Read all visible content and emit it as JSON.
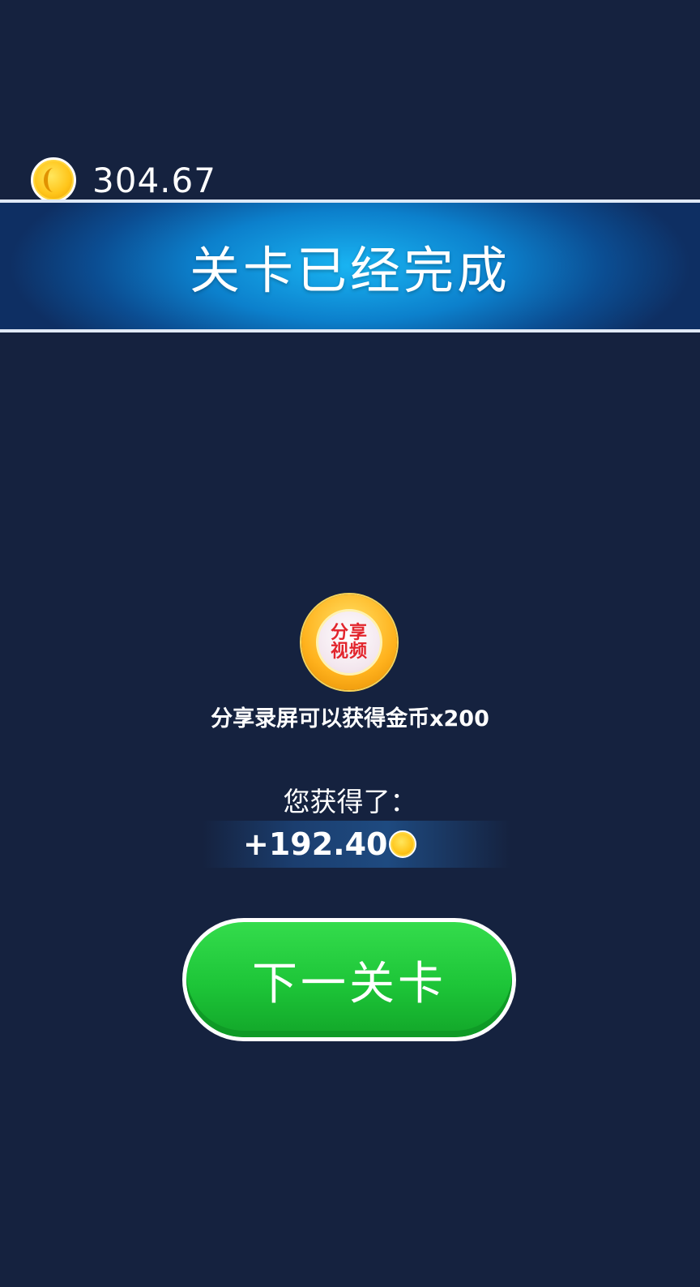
{
  "header": {
    "coin_icon": "gold-coin-icon",
    "balance": "304.67"
  },
  "banner": {
    "title": "关卡已经完成"
  },
  "share": {
    "badge_line1": "分享",
    "badge_line2": "视频",
    "hint": "分享录屏可以获得金币x200"
  },
  "reward": {
    "label": "您获得了：",
    "amount": "+192.40",
    "coin_icon": "gold-coin-icon"
  },
  "actions": {
    "next_label": "下一关卡"
  },
  "colors": {
    "background": "#15223f",
    "banner_accent": "#19b4f2",
    "button_green": "#1dc538",
    "coin_gold": "#ffc51a",
    "share_red": "#e2242c"
  }
}
